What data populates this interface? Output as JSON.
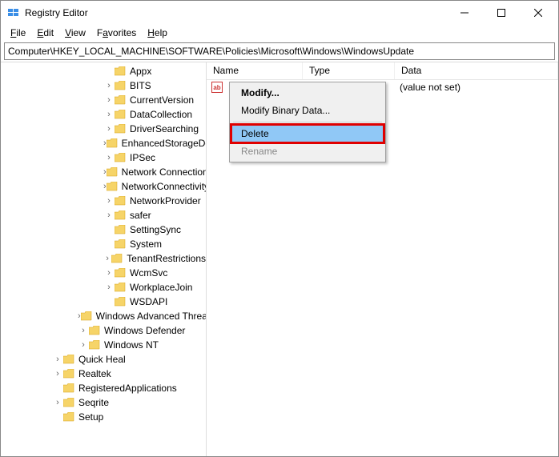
{
  "window": {
    "title": "Registry Editor"
  },
  "menu": {
    "file": "File",
    "edit": "Edit",
    "view": "View",
    "favorites": "Favorites",
    "help": "Help"
  },
  "address": "Computer\\HKEY_LOCAL_MACHINE\\SOFTWARE\\Policies\\Microsoft\\Windows\\WindowsUpdate",
  "columns": {
    "name": "Name",
    "type": "Type",
    "data": "Data"
  },
  "list": {
    "row0": {
      "data": "(value not set)"
    }
  },
  "context_menu": {
    "modify": "Modify...",
    "modify_binary": "Modify Binary Data...",
    "delete": "Delete",
    "rename": "Rename"
  },
  "tree": {
    "items": [
      "Appx",
      "BITS",
      "CurrentVersion",
      "DataCollection",
      "DriverSearching",
      "EnhancedStorageDevices",
      "IPSec",
      "Network Connections",
      "NetworkConnectivityStatusIndicator",
      "NetworkProvider",
      "safer",
      "SettingSync",
      "System",
      "TenantRestrictions",
      "WcmSvc",
      "WorkplaceJoin",
      "WSDAPI"
    ],
    "windows_siblings": [
      "Windows Advanced Threat Protection",
      "Windows Defender",
      "Windows NT"
    ],
    "after": [
      "Quick Heal",
      "Realtek",
      "RegisteredApplications",
      "Seqrite",
      "Setup"
    ]
  }
}
